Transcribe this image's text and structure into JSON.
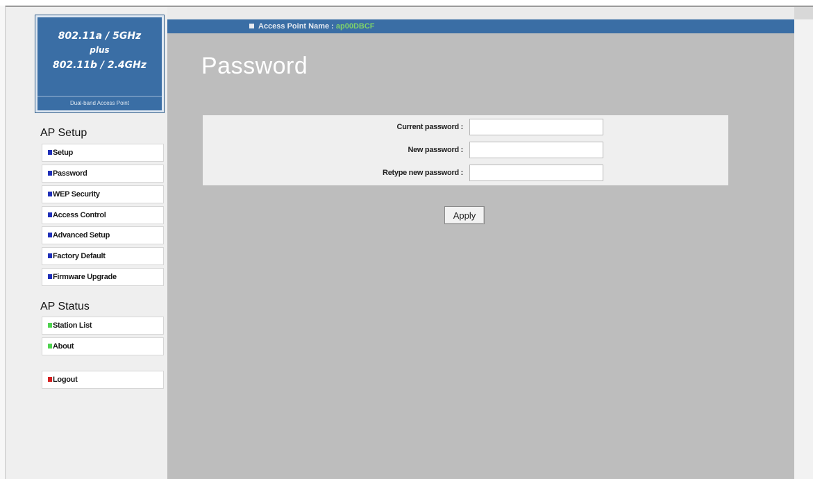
{
  "logo": {
    "line1": "802.11a / 5GHz",
    "line2": "plus",
    "line3": "802.11b / 2.4GHz",
    "subtitle": "Dual-band Access Point"
  },
  "header": {
    "label": "Access Point Name :",
    "value": "ap00DBCF"
  },
  "sidebar": {
    "setup_title": "AP Setup",
    "setup_items": [
      {
        "label": "Setup",
        "bullet_color": "#1f2fb8"
      },
      {
        "label": "Password",
        "bullet_color": "#1f2fb8"
      },
      {
        "label": "WEP Security",
        "bullet_color": "#1f2fb8"
      },
      {
        "label": "Access Control",
        "bullet_color": "#1f2fb8"
      },
      {
        "label": "Advanced Setup",
        "bullet_color": "#1f2fb8"
      },
      {
        "label": "Factory Default",
        "bullet_color": "#1f2fb8"
      },
      {
        "label": "Firmware Upgrade",
        "bullet_color": "#1f2fb8"
      }
    ],
    "status_title": "AP Status",
    "status_items": [
      {
        "label": "Station List",
        "bullet_color": "#4fd24f"
      },
      {
        "label": "About",
        "bullet_color": "#4fd24f"
      }
    ],
    "logout": {
      "label": "Logout",
      "bullet_color": "#d42020"
    }
  },
  "main": {
    "title": "Password",
    "form": {
      "current_label": "Current password :",
      "current_value": "",
      "new_label": "New password :",
      "new_value": "",
      "retype_label": "Retype new password :",
      "retype_value": ""
    },
    "apply_label": "Apply"
  },
  "colors": {
    "accent_blue": "#3a6ea5",
    "content_gray": "#bdbdbd",
    "ap_name_green": "#7fd36a"
  }
}
